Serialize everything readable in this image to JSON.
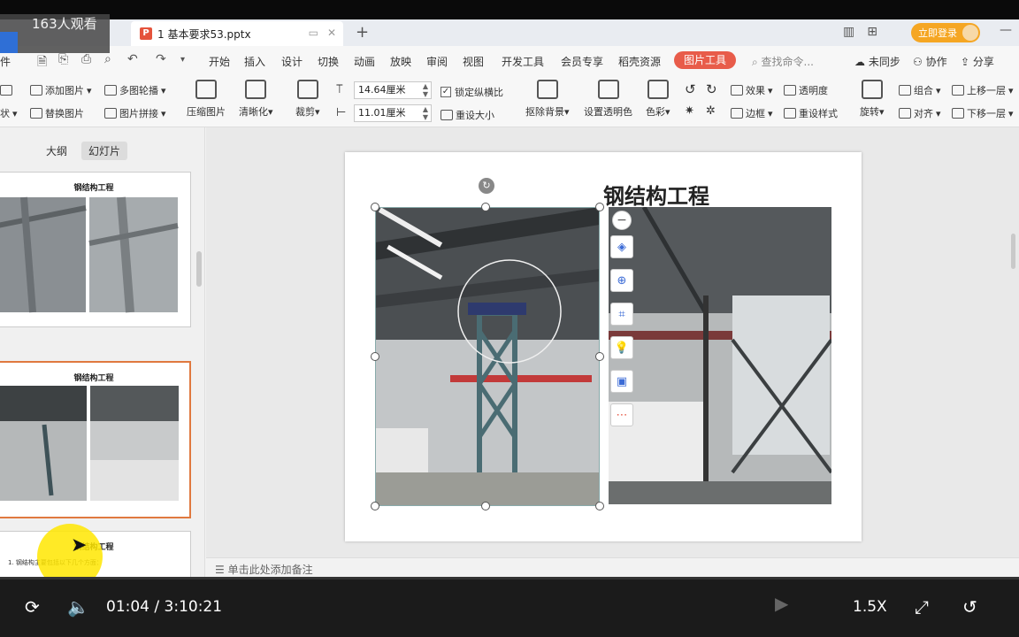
{
  "overlay": {
    "viewers": "163人观看"
  },
  "titlebar": {
    "tab_title": "1 基本要求53.pptx",
    "login_label": "立即登录"
  },
  "menu": {
    "items": [
      "开始",
      "插入",
      "设计",
      "切换",
      "动画",
      "放映",
      "审阅",
      "视图",
      "开发工具",
      "会员专享",
      "稻壳资源"
    ],
    "active": "图片工具",
    "search_placeholder": "查找命令...",
    "sync": "未同步",
    "collab": "协作",
    "share": "分享"
  },
  "ribbon": {
    "add_picture": "添加图片",
    "multi_carousel": "多图轮播",
    "replace_picture": "替换图片",
    "picture_collage": "图片拼接",
    "compress": "压缩图片",
    "sharpen": "清晰化",
    "crop": "裁剪",
    "width": "14.64厘米",
    "height": "11.01厘米",
    "lock_ratio": "锁定纵横比",
    "reset_size": "重设大小",
    "remove_bg": "抠除背景",
    "set_transparent_color": "设置透明色",
    "color": "色彩",
    "effects": "效果",
    "transparency": "透明度",
    "border": "边框",
    "reset_style": "重设样式",
    "rotate": "旋转",
    "group": "组合",
    "align": "对齐",
    "bring_forward": "上移一层",
    "send_backward": "下移一层",
    "left_cut_1": "状",
    "left_cut_2": "件"
  },
  "leftpane": {
    "tab_outline": "大纲",
    "tab_slides": "幻灯片",
    "thumb_titles": [
      "钢结构工程",
      "钢结构工程",
      "钢结构工程"
    ],
    "thumb3_line": "1. 钢结构主要包括以下几个方面："
  },
  "slide": {
    "title": "钢结构工程"
  },
  "notes": {
    "placeholder": "单击此处添加备注"
  },
  "video": {
    "time": "01:04 / 3:10:21",
    "speed": "1.5X"
  }
}
